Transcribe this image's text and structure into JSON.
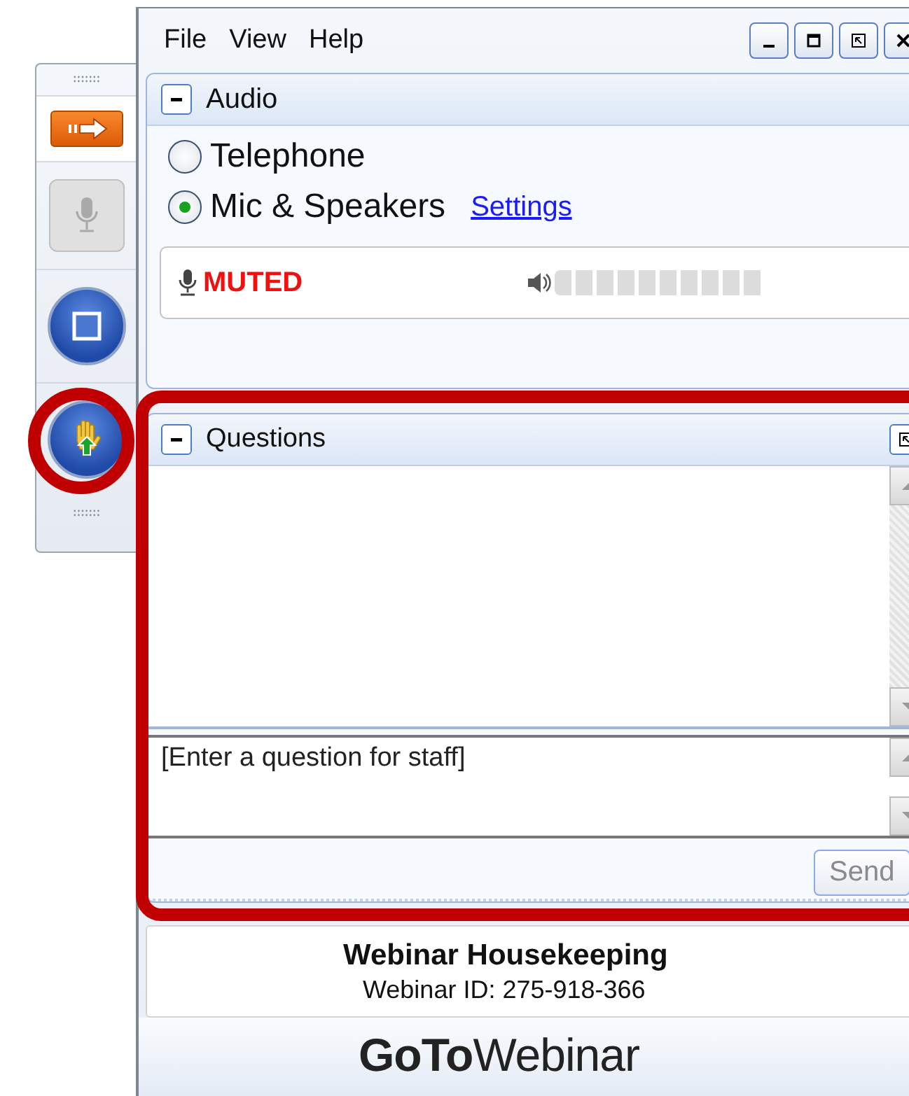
{
  "menu": [
    "File",
    "View",
    "Help"
  ],
  "toolbar": {
    "mic_disabled": true
  },
  "audio": {
    "title": "Audio",
    "expanded": true,
    "options": [
      {
        "label": "Telephone",
        "selected": false
      },
      {
        "label": "Mic & Speakers",
        "selected": true
      }
    ],
    "settings_link": "Settings",
    "mic_status": "MUTED",
    "meter": {
      "level": 0
    }
  },
  "questions": {
    "title": "Questions",
    "expanded": true,
    "placeholder": "[Enter a question for staff]",
    "send": "Send",
    "send_disabled": true
  },
  "webinar": {
    "title": "Webinar Housekeeping",
    "id_text": "Webinar ID: 275-918-366"
  },
  "logo": "**GoTo**Webinar"
}
